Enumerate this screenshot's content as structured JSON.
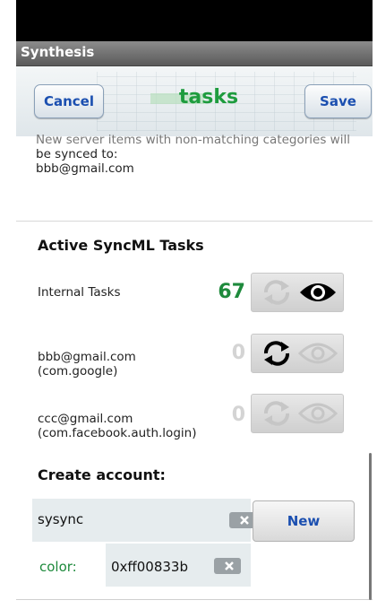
{
  "app": {
    "title": "Synthesis"
  },
  "header": {
    "cancel_label": "Cancel",
    "title": "tasks",
    "save_label": "Save"
  },
  "info": {
    "line1": "New server items with non-matching categories will",
    "line2": "be synced to:",
    "line3": "bbb@gmail.com"
  },
  "tasks_section": {
    "title": "Active SyncML Tasks",
    "rows": [
      {
        "label_line1": "Internal Tasks",
        "label_line2": "",
        "count": "67",
        "sync_enabled": false,
        "view_enabled": true
      },
      {
        "label_line1": "bbb@gmail.com",
        "label_line2": "(com.google)",
        "count": "0",
        "sync_enabled": true,
        "view_enabled": false
      },
      {
        "label_line1": "ccc@gmail.com",
        "label_line2": "(com.facebook.auth.login)",
        "count": "0",
        "sync_enabled": false,
        "view_enabled": false
      }
    ]
  },
  "create_account": {
    "title": "Create account:",
    "name_value": "sysync",
    "new_label": "New",
    "color_label": "color:",
    "color_value": "0xff00833b"
  },
  "icons": [
    "sync-icon",
    "eye-icon",
    "clear-text-icon"
  ],
  "colors": {
    "accent_green": "#1e9c3e",
    "button_text_blue": "#1b4fb0",
    "count_green": "#1e8a3c"
  }
}
